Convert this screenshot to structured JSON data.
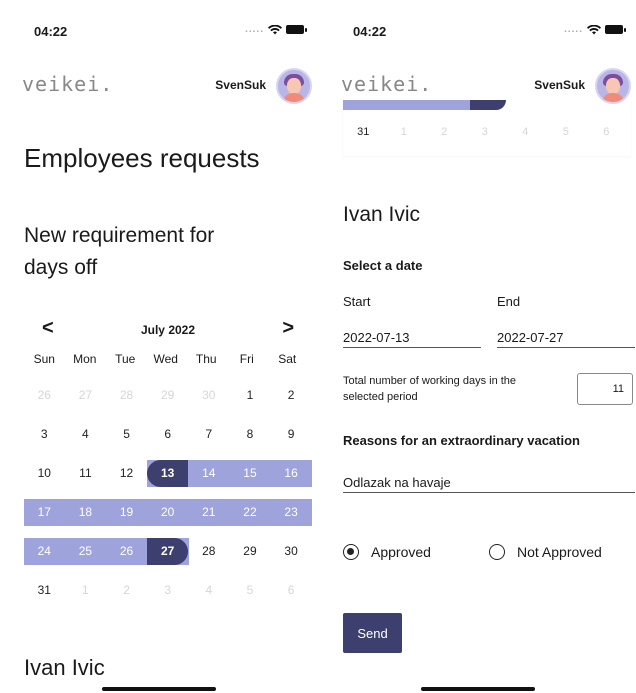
{
  "status": {
    "time": "04:22",
    "signal": "....."
  },
  "header": {
    "logo": "veikei.",
    "username": "SvenSuk"
  },
  "left": {
    "title": "Employees requests",
    "subtitle": "New requirement for days off",
    "next_section_name": "Ivan Ivic",
    "calendar": {
      "month": "July 2022",
      "prev": "<",
      "next": ">",
      "weekdays": [
        "Sun",
        "Mon",
        "Tue",
        "Wed",
        "Thu",
        "Fri",
        "Sat"
      ],
      "weeks": [
        [
          {
            "d": "26",
            "s": "muted"
          },
          {
            "d": "27",
            "s": "muted"
          },
          {
            "d": "28",
            "s": "muted"
          },
          {
            "d": "29",
            "s": "muted"
          },
          {
            "d": "30",
            "s": "muted"
          },
          {
            "d": "1",
            "s": "normal"
          },
          {
            "d": "2",
            "s": "normal"
          }
        ],
        [
          {
            "d": "3",
            "s": "normal"
          },
          {
            "d": "4",
            "s": "normal"
          },
          {
            "d": "5",
            "s": "normal"
          },
          {
            "d": "6",
            "s": "normal"
          },
          {
            "d": "7",
            "s": "normal"
          },
          {
            "d": "8",
            "s": "normal"
          },
          {
            "d": "9",
            "s": "normal"
          }
        ],
        [
          {
            "d": "10",
            "s": "normal"
          },
          {
            "d": "11",
            "s": "normal"
          },
          {
            "d": "12",
            "s": "normal"
          },
          {
            "d": "13",
            "s": "start"
          },
          {
            "d": "14",
            "s": "inrange"
          },
          {
            "d": "15",
            "s": "inrange"
          },
          {
            "d": "16",
            "s": "inrange"
          }
        ],
        [
          {
            "d": "17",
            "s": "inrange"
          },
          {
            "d": "18",
            "s": "inrange"
          },
          {
            "d": "19",
            "s": "inrange"
          },
          {
            "d": "20",
            "s": "inrange"
          },
          {
            "d": "21",
            "s": "inrange"
          },
          {
            "d": "22",
            "s": "inrange"
          },
          {
            "d": "23",
            "s": "inrange"
          }
        ],
        [
          {
            "d": "24",
            "s": "inrange"
          },
          {
            "d": "25",
            "s": "inrange"
          },
          {
            "d": "26",
            "s": "inrange"
          },
          {
            "d": "27",
            "s": "end"
          },
          {
            "d": "28",
            "s": "normal"
          },
          {
            "d": "29",
            "s": "normal"
          },
          {
            "d": "30",
            "s": "normal"
          }
        ],
        [
          {
            "d": "31",
            "s": "normal"
          },
          {
            "d": "1",
            "s": "muted"
          },
          {
            "d": "2",
            "s": "muted"
          },
          {
            "d": "3",
            "s": "muted"
          },
          {
            "d": "4",
            "s": "muted"
          },
          {
            "d": "5",
            "s": "muted"
          },
          {
            "d": "6",
            "s": "muted"
          }
        ]
      ]
    }
  },
  "right": {
    "calendar_fragment_days": [
      "31",
      "1",
      "2",
      "3",
      "4",
      "5",
      "6"
    ],
    "name": "Ivan Ivic",
    "select_date": "Select a date",
    "start_label": "Start",
    "end_label": "End",
    "start_value": "2022-07-13",
    "end_value": "2022-07-27",
    "working_days_label": "Total number of working days in the selected period",
    "working_days_value": "11",
    "reasons_label": "Reasons for an extraordinary vacation",
    "reason_value": "Odlazak na havaje",
    "approved_label": "Approved",
    "not_approved_label": "Not Approved",
    "selected": "approved",
    "send_label": "Send"
  },
  "colors": {
    "range": "#9ea3db",
    "edge": "#3d3f6e",
    "button": "#3d3f6e"
  }
}
